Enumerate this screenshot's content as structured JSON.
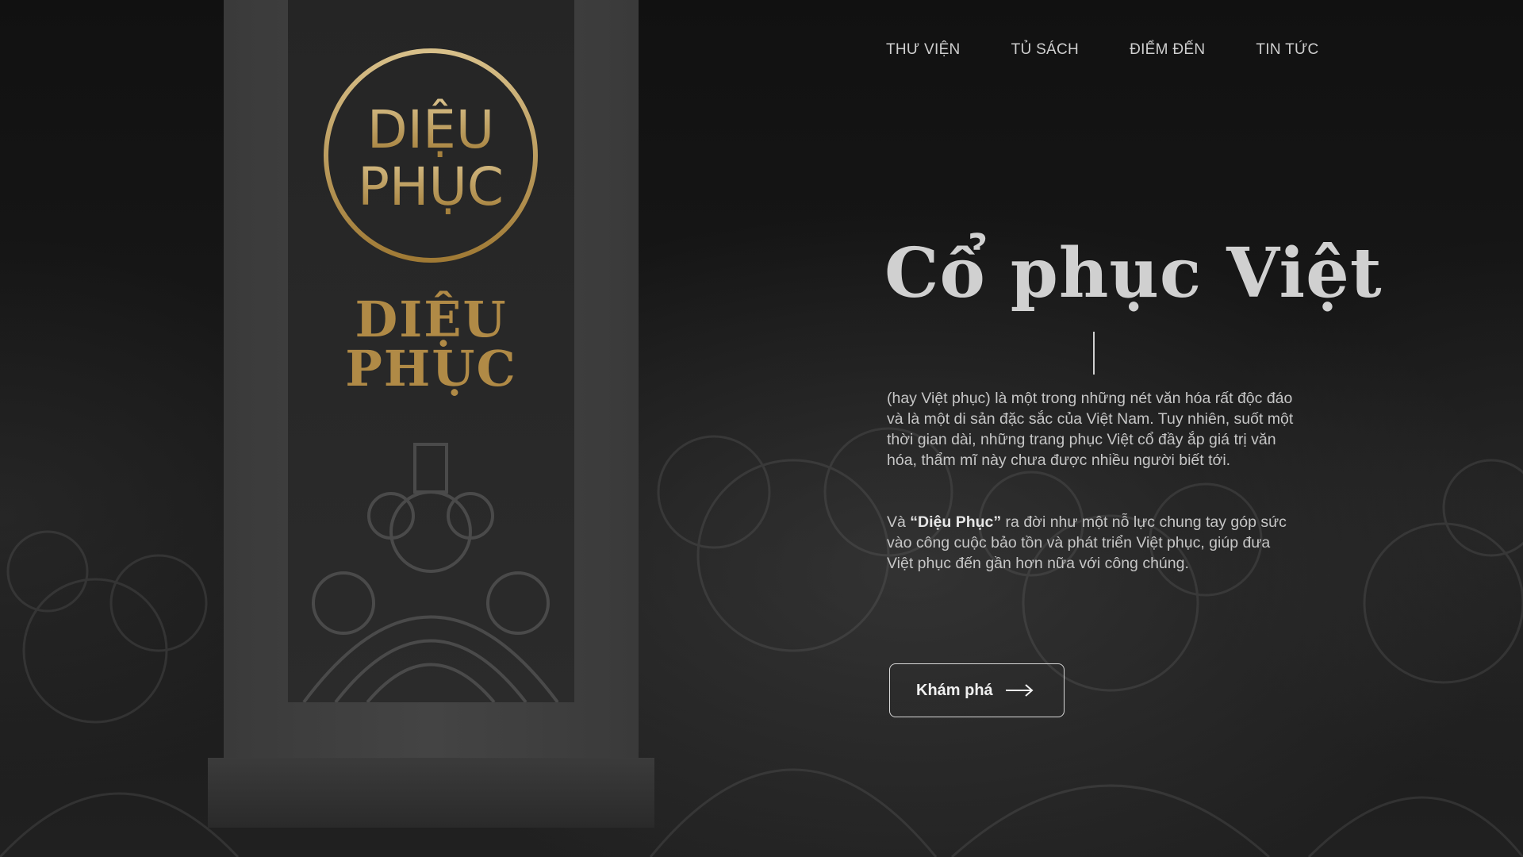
{
  "nav": {
    "items": [
      {
        "label": "THƯ VIỆN"
      },
      {
        "label": "TỦ SÁCH"
      },
      {
        "label": "ĐIỂM ĐẾN"
      },
      {
        "label": "TIN TỨC"
      }
    ]
  },
  "brand": {
    "seal_text_top": "DIỆU",
    "seal_text_bottom": "PHỤC",
    "name_line1": "DIỆU",
    "name_line2": "PHỤC",
    "accent_color": "#b08a46"
  },
  "hero": {
    "title": "Cổ phục Việt",
    "paragraph1": "(hay Việt phục) là một trong những nét văn hóa rất độc đáo và là một di sản đặc sắc của Việt Nam. Tuy nhiên, suốt một thời gian dài, những trang phục Việt cổ đầy ắp giá trị văn hóa, thẩm mĩ này chưa được nhiều người biết tới.",
    "paragraph2_prefix": "Và ",
    "paragraph2_bold": "“Diệu Phục”",
    "paragraph2_suffix": " ra đời như một nỗ lực chung tay góp sức vào công cuộc bảo tồn và phát triển Việt phục, giúp đưa Việt phục đến gần hơn nữa với công chúng.",
    "cta_label": "Khám phá",
    "cta_icon": "arrow-right-icon"
  }
}
